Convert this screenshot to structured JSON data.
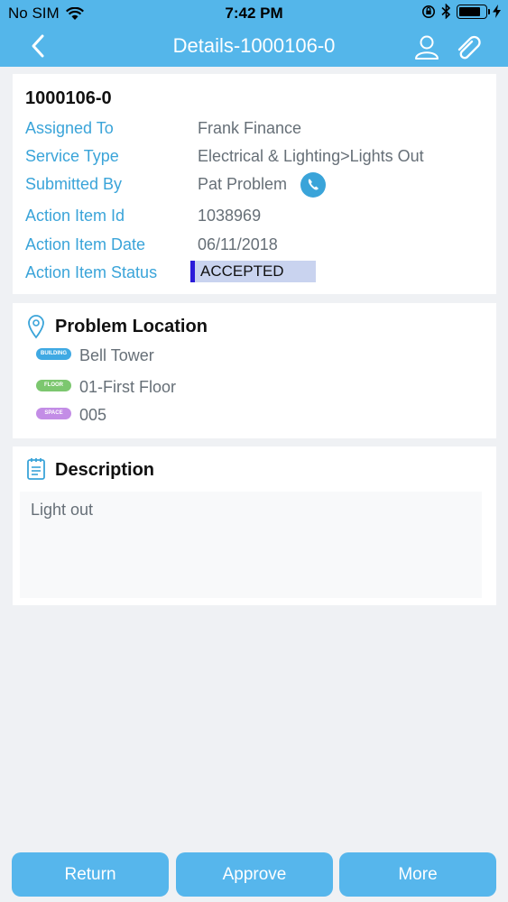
{
  "status_bar": {
    "carrier": "No SIM",
    "time": "7:42 PM",
    "icons": [
      "wifi-icon",
      "orientation-lock-icon",
      "bluetooth-icon",
      "battery-icon",
      "charging-icon"
    ],
    "battery_level": 0.85
  },
  "nav": {
    "title": "Details-1000106-0",
    "icons": [
      "back-chevron-icon",
      "user-icon",
      "paperclip-icon"
    ],
    "color": "#54b6ea"
  },
  "details": {
    "item_number": "1000106-0",
    "rows": [
      {
        "label": "Assigned To",
        "value": "Frank Finance"
      },
      {
        "label": "Service Type",
        "value": "Electrical & Lighting>Lights Out"
      },
      {
        "label": "Submitted By",
        "value": "Pat Problem"
      },
      {
        "label": "Action Item Id",
        "value": "1038969"
      },
      {
        "label": "Action Item Date",
        "value": "06/11/2018"
      },
      {
        "label": "Action Item Status",
        "value": "ACCEPTED"
      }
    ]
  },
  "location": {
    "title": "Problem Location",
    "items": [
      {
        "tag": "BUILDING",
        "tag_color": "#3fa9e3",
        "value": "Bell Tower"
      },
      {
        "tag": "FLOOR",
        "tag_color": "#7cc76f",
        "value": "01-First Floor"
      },
      {
        "tag": "SPACE",
        "tag_color": "#c38de6",
        "value": "005"
      }
    ]
  },
  "description": {
    "title": "Description",
    "text": "Light out"
  },
  "actions": {
    "return": "Return",
    "approve": "Approve",
    "more": "More"
  }
}
